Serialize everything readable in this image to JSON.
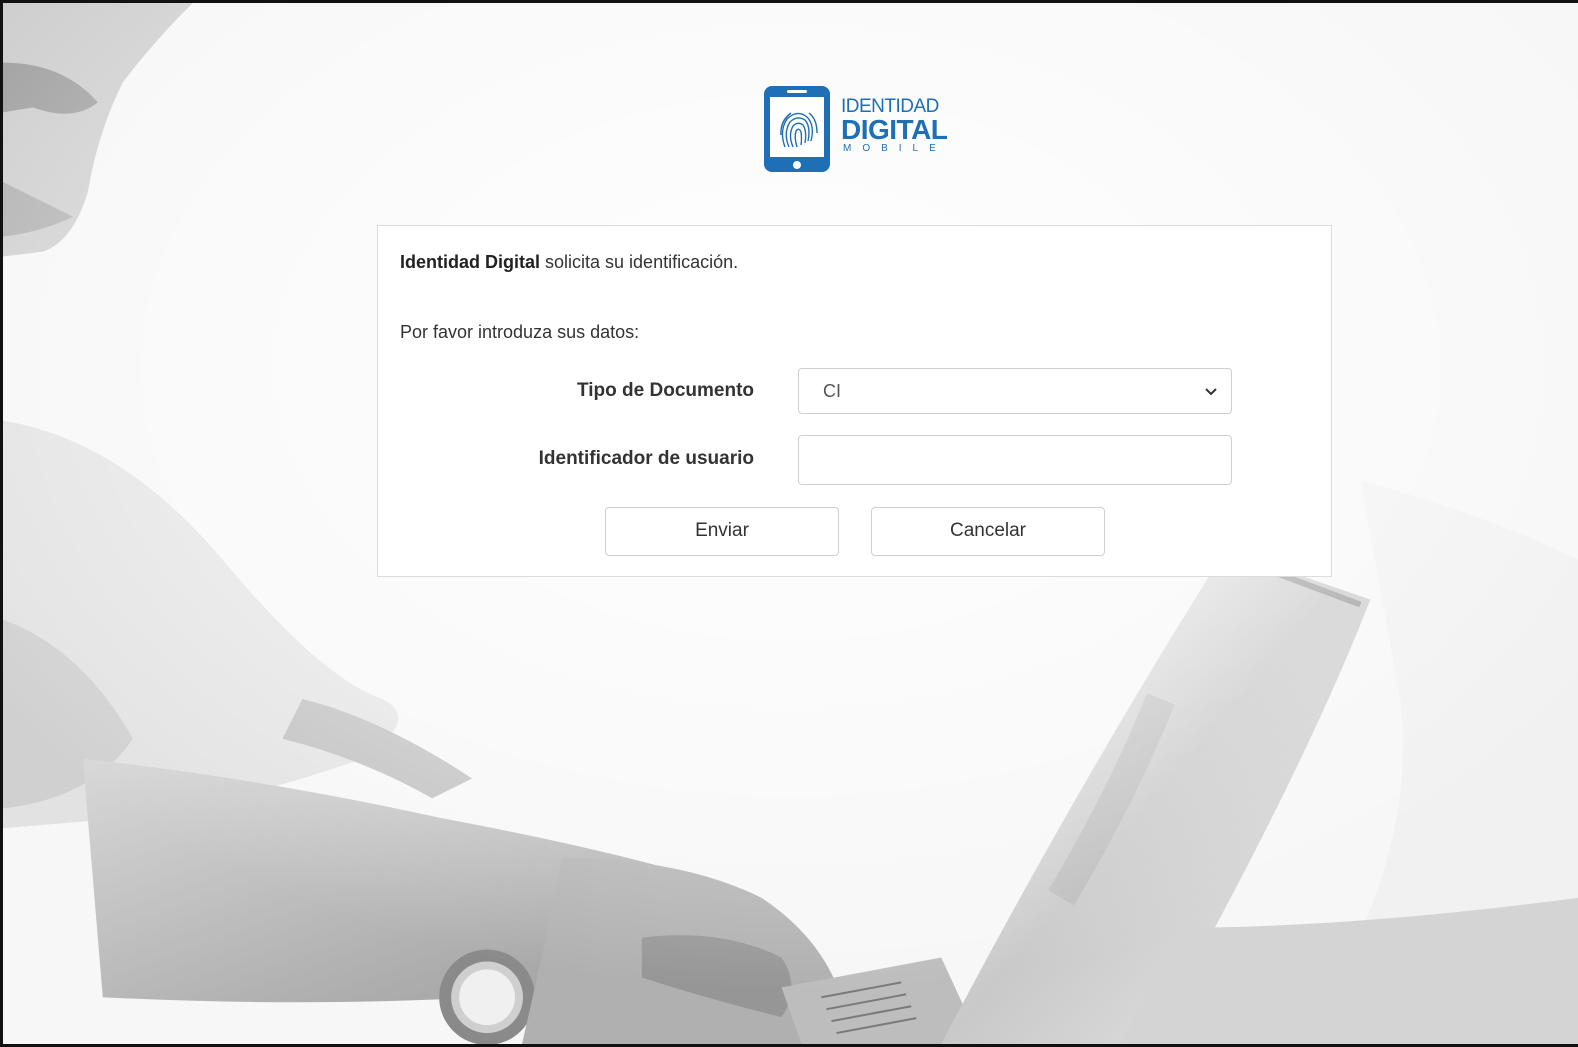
{
  "logo": {
    "line1": "IDENTIDAD",
    "line2": "DIGITAL",
    "line3": "MOBILE",
    "color": "#1e6fb5"
  },
  "intro": {
    "app_name": "Identidad Digital",
    "message": " solicita su identificación."
  },
  "prompt": "Por favor introduza sus datos:",
  "form": {
    "doc_type_label": "Tipo de Documento",
    "doc_type_value": "CI",
    "user_id_label": "Identificador de usuario",
    "user_id_value": ""
  },
  "buttons": {
    "send": "Enviar",
    "cancel": "Cancelar"
  },
  "icons": {
    "phone": "phone-fingerprint-icon",
    "chevron": "chevron-down-icon"
  }
}
